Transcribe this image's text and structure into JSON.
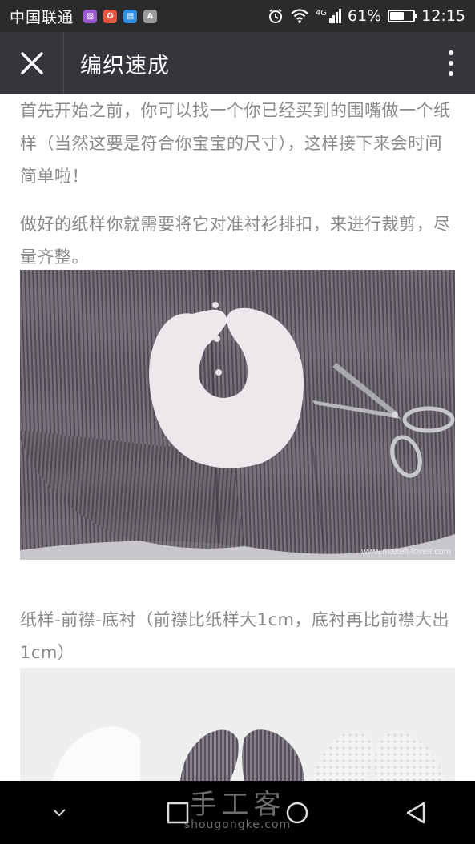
{
  "status_bar": {
    "carrier": "中国联通",
    "app_icons": [
      {
        "name": "gallery-app-icon",
        "color": "#9b59d0",
        "glyph": "▨"
      },
      {
        "name": "security-app-icon",
        "color": "#e8553d",
        "glyph": "✪"
      },
      {
        "name": "weibo-app-icon",
        "color": "#2f8fe0",
        "glyph": "▤"
      },
      {
        "name": "keyboard-app-icon",
        "color": "#9a9a9a",
        "glyph": "A"
      }
    ],
    "network": "4G",
    "battery_percent": "61%",
    "battery_level": 0.61,
    "time": "12:15"
  },
  "title_bar": {
    "title": "编织速成"
  },
  "content": {
    "paragraph_1": "首先开始之前，你可以找一个你已经买到的围嘴做一个纸样（当然这要是符合你宝宝的尺寸），这样接下来会时间简单啦！",
    "paragraph_2": "做好的纸样你就需要将它对准衬衫排扣，来进行裁剪，尽量齐整。",
    "photo_1_watermark": "www.makeit-loveit.com",
    "paragraph_3": "纸样-前襟-底衬（前襟比纸样大1cm，底衬再比前襟大出1cm）"
  },
  "overlay_watermark": {
    "main": "手工客",
    "sub": "shougongke.com"
  },
  "colors": {
    "status_bar_bg": "#2b2b2d",
    "title_bar_bg": "#35353b",
    "body_text": "#8a8a8a",
    "nav_bar_bg": "#000000"
  }
}
